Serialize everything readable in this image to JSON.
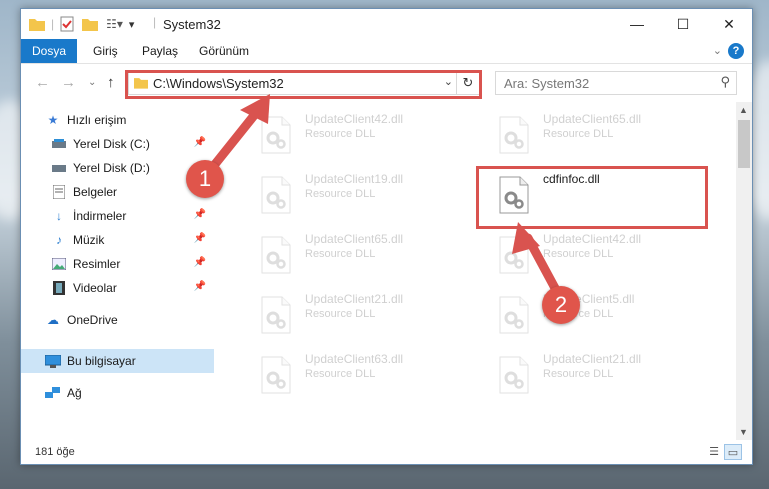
{
  "window": {
    "title": "System32"
  },
  "ribbon": {
    "tabs": [
      "Dosya",
      "Giriş",
      "Paylaş",
      "Görünüm"
    ]
  },
  "address": {
    "path": "C:\\Windows\\System32"
  },
  "search": {
    "placeholder": "Ara: System32"
  },
  "sidebar": {
    "items": [
      {
        "label": "Hızlı erişim",
        "icon": "star-icon",
        "pinned": false
      },
      {
        "label": "Yerel Disk (C:)",
        "icon": "drive-icon",
        "pinned": true
      },
      {
        "label": "Yerel Disk (D:)",
        "icon": "drive-icon",
        "pinned": false
      },
      {
        "label": "Belgeler",
        "icon": "documents-icon",
        "pinned": false
      },
      {
        "label": "İndirmeler",
        "icon": "download-icon",
        "pinned": true
      },
      {
        "label": "Müzik",
        "icon": "music-icon",
        "pinned": true
      },
      {
        "label": "Resimler",
        "icon": "pictures-icon",
        "pinned": true
      },
      {
        "label": "Videolar",
        "icon": "video-icon",
        "pinned": true
      },
      {
        "label": "OneDrive",
        "icon": "cloud-icon",
        "pinned": false
      },
      {
        "label": "Bu bilgisayar",
        "icon": "computer-icon",
        "pinned": false,
        "selected": true
      },
      {
        "label": "Ağ",
        "icon": "network-icon",
        "pinned": false
      }
    ]
  },
  "files": {
    "left": [
      {
        "name": "UpdateClient42.dll",
        "type": "Resource DLL"
      },
      {
        "name": "UpdateClient19.dll",
        "type": "Resource DLL"
      },
      {
        "name": "UpdateClient65.dll",
        "type": "Resource DLL"
      },
      {
        "name": "UpdateClient21.dll",
        "type": "Resource DLL"
      },
      {
        "name": "UpdateClient63.dll",
        "type": "Resource DLL"
      }
    ],
    "right": [
      {
        "name": "UpdateClient65.dll",
        "type": "Resource DLL"
      },
      {
        "name": "cdfinfoc.dll",
        "type": ""
      },
      {
        "name": "UpdateClient42.dll",
        "type": "Resource DLL"
      },
      {
        "name": "UpdateClient5.dll",
        "type": "Resource DLL"
      },
      {
        "name": "UpdateClient21.dll",
        "type": "Resource DLL"
      }
    ]
  },
  "status": {
    "count": "181 öğe"
  },
  "annotations": {
    "badge1": "1",
    "badge2": "2",
    "color": "#d9534f"
  }
}
